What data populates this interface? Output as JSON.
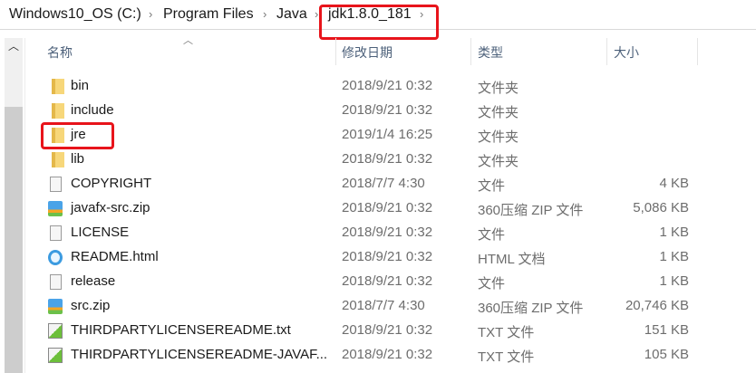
{
  "breadcrumb": [
    "Windows10_OS (C:)",
    "Program Files",
    "Java",
    "jdk1.8.0_181"
  ],
  "columns": {
    "name": "名称",
    "date": "修改日期",
    "type": "类型",
    "size": "大小"
  },
  "files": [
    {
      "name": "bin",
      "date": "2018/9/21 0:32",
      "type": "文件夹",
      "size": "",
      "icon": "folder"
    },
    {
      "name": "include",
      "date": "2018/9/21 0:32",
      "type": "文件夹",
      "size": "",
      "icon": "folder"
    },
    {
      "name": "jre",
      "date": "2019/1/4 16:25",
      "type": "文件夹",
      "size": "",
      "icon": "folder"
    },
    {
      "name": "lib",
      "date": "2018/9/21 0:32",
      "type": "文件夹",
      "size": "",
      "icon": "folder"
    },
    {
      "name": "COPYRIGHT",
      "date": "2018/7/7 4:30",
      "type": "文件",
      "size": "4 KB",
      "icon": "file"
    },
    {
      "name": "javafx-src.zip",
      "date": "2018/9/21 0:32",
      "type": "360压缩 ZIP 文件",
      "size": "5,086 KB",
      "icon": "zip"
    },
    {
      "name": "LICENSE",
      "date": "2018/9/21 0:32",
      "type": "文件",
      "size": "1 KB",
      "icon": "file"
    },
    {
      "name": "README.html",
      "date": "2018/9/21 0:32",
      "type": "HTML 文档",
      "size": "1 KB",
      "icon": "ie"
    },
    {
      "name": "release",
      "date": "2018/9/21 0:32",
      "type": "文件",
      "size": "1 KB",
      "icon": "file"
    },
    {
      "name": "src.zip",
      "date": "2018/7/7 4:30",
      "type": "360压缩 ZIP 文件",
      "size": "20,746 KB",
      "icon": "zip"
    },
    {
      "name": "THIRDPARTYLICENSEREADME.txt",
      "date": "2018/9/21 0:32",
      "type": "TXT 文件",
      "size": "151 KB",
      "icon": "txt"
    },
    {
      "name": "THIRDPARTYLICENSEREADME-JAVAF...",
      "date": "2018/9/21 0:32",
      "type": "TXT 文件",
      "size": "105 KB",
      "icon": "txt"
    }
  ],
  "highlight_color": "#e8141b"
}
